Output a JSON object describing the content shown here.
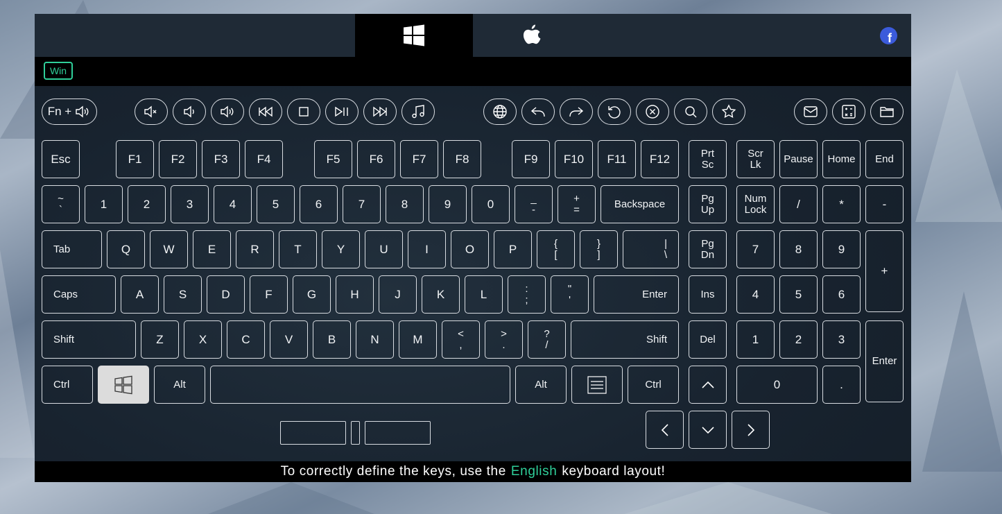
{
  "header": {
    "tabs": [
      {
        "name": "windows",
        "icon": "windows-logo-icon",
        "active": true
      },
      {
        "name": "mac",
        "icon": "apple-logo-icon",
        "active": false
      }
    ],
    "facebook_icon": "facebook-icon",
    "facebook_letter": "f",
    "os_badge": "Win"
  },
  "media_row": {
    "fn_label": "Fn +",
    "icons": [
      "speaker-icon",
      "mute-icon",
      "volume-down-icon",
      "volume-up-icon",
      "previous-track-icon",
      "stop-icon",
      "play-pause-icon",
      "next-track-icon",
      "music-icon",
      "globe-icon",
      "back-icon",
      "forward-icon",
      "refresh-icon",
      "cancel-icon",
      "search-icon",
      "favorites-icon",
      "mail-icon",
      "calculator-icon",
      "folder-icon"
    ]
  },
  "keys": {
    "esc": "Esc",
    "f1": "F1",
    "f2": "F2",
    "f3": "F3",
    "f4": "F4",
    "f5": "F5",
    "f6": "F6",
    "f7": "F7",
    "f8": "F8",
    "f9": "F9",
    "f10": "F10",
    "f11": "F11",
    "f12": "F12",
    "prtsc_1": "Prt",
    "prtsc_2": "Sc",
    "scrlk_1": "Scr",
    "scrlk_2": "Lk",
    "pause": "Pause",
    "home": "Home",
    "end": "End",
    "tilde_1": "~",
    "tilde_2": "`",
    "d1": "1",
    "d2": "2",
    "d3": "3",
    "d4": "4",
    "d5": "5",
    "d6": "6",
    "d7": "7",
    "d8": "8",
    "d9": "9",
    "d0": "0",
    "minus_1": "_",
    "minus_2": "-",
    "plus_1": "+",
    "plus_2": "=",
    "backspace": "Backspace",
    "pgup_1": "Pg",
    "pgup_2": "Up",
    "numlock_1": "Num",
    "numlock_2": "Lock",
    "np_div": "/",
    "np_mul": "*",
    "np_sub": "-",
    "tab": "Tab",
    "q": "Q",
    "w": "W",
    "e": "E",
    "r": "R",
    "t": "T",
    "y": "Y",
    "u": "U",
    "i": "I",
    "o": "O",
    "p": "P",
    "lbr_1": "{",
    "lbr_2": "[",
    "rbr_1": "}",
    "rbr_2": "]",
    "bsl_1": "|",
    "bsl_2": "\\",
    "pgdn_1": "Pg",
    "pgdn_2": "Dn",
    "np7": "7",
    "np8": "8",
    "np9": "9",
    "np_add": "+",
    "caps": "Caps",
    "a": "A",
    "s": "S",
    "d": "D",
    "f": "F",
    "g": "G",
    "h": "H",
    "j": "J",
    "k": "K",
    "l": "L",
    "semi_1": ":",
    "semi_2": ";",
    "quot_1": "\"",
    "quot_2": "'",
    "enter": "Enter",
    "ins": "Ins",
    "np4": "4",
    "np5": "5",
    "np6": "6",
    "lshift": "Shift",
    "z": "Z",
    "x": "X",
    "c": "C",
    "v": "V",
    "b": "B",
    "n": "N",
    "m": "M",
    "comma_1": "<",
    "comma_2": ",",
    "period_1": ">",
    "period_2": ".",
    "slash_1": "?",
    "slash_2": "/",
    "rshift": "Shift",
    "del": "Del",
    "np1": "1",
    "np2": "2",
    "np3": "3",
    "np_enter": "Enter",
    "lctrl": "Ctrl",
    "lalt": "Alt",
    "ralt": "Alt",
    "rctrl": "Ctrl",
    "np0": "0",
    "np_dec": "."
  },
  "footer": {
    "before": "To correctly define the keys, use the",
    "highlight": "English",
    "after": "keyboard layout!"
  },
  "colors": {
    "accent": "#2fcf9a",
    "panel": "#17222e",
    "active_key": "#dcdcdc"
  }
}
